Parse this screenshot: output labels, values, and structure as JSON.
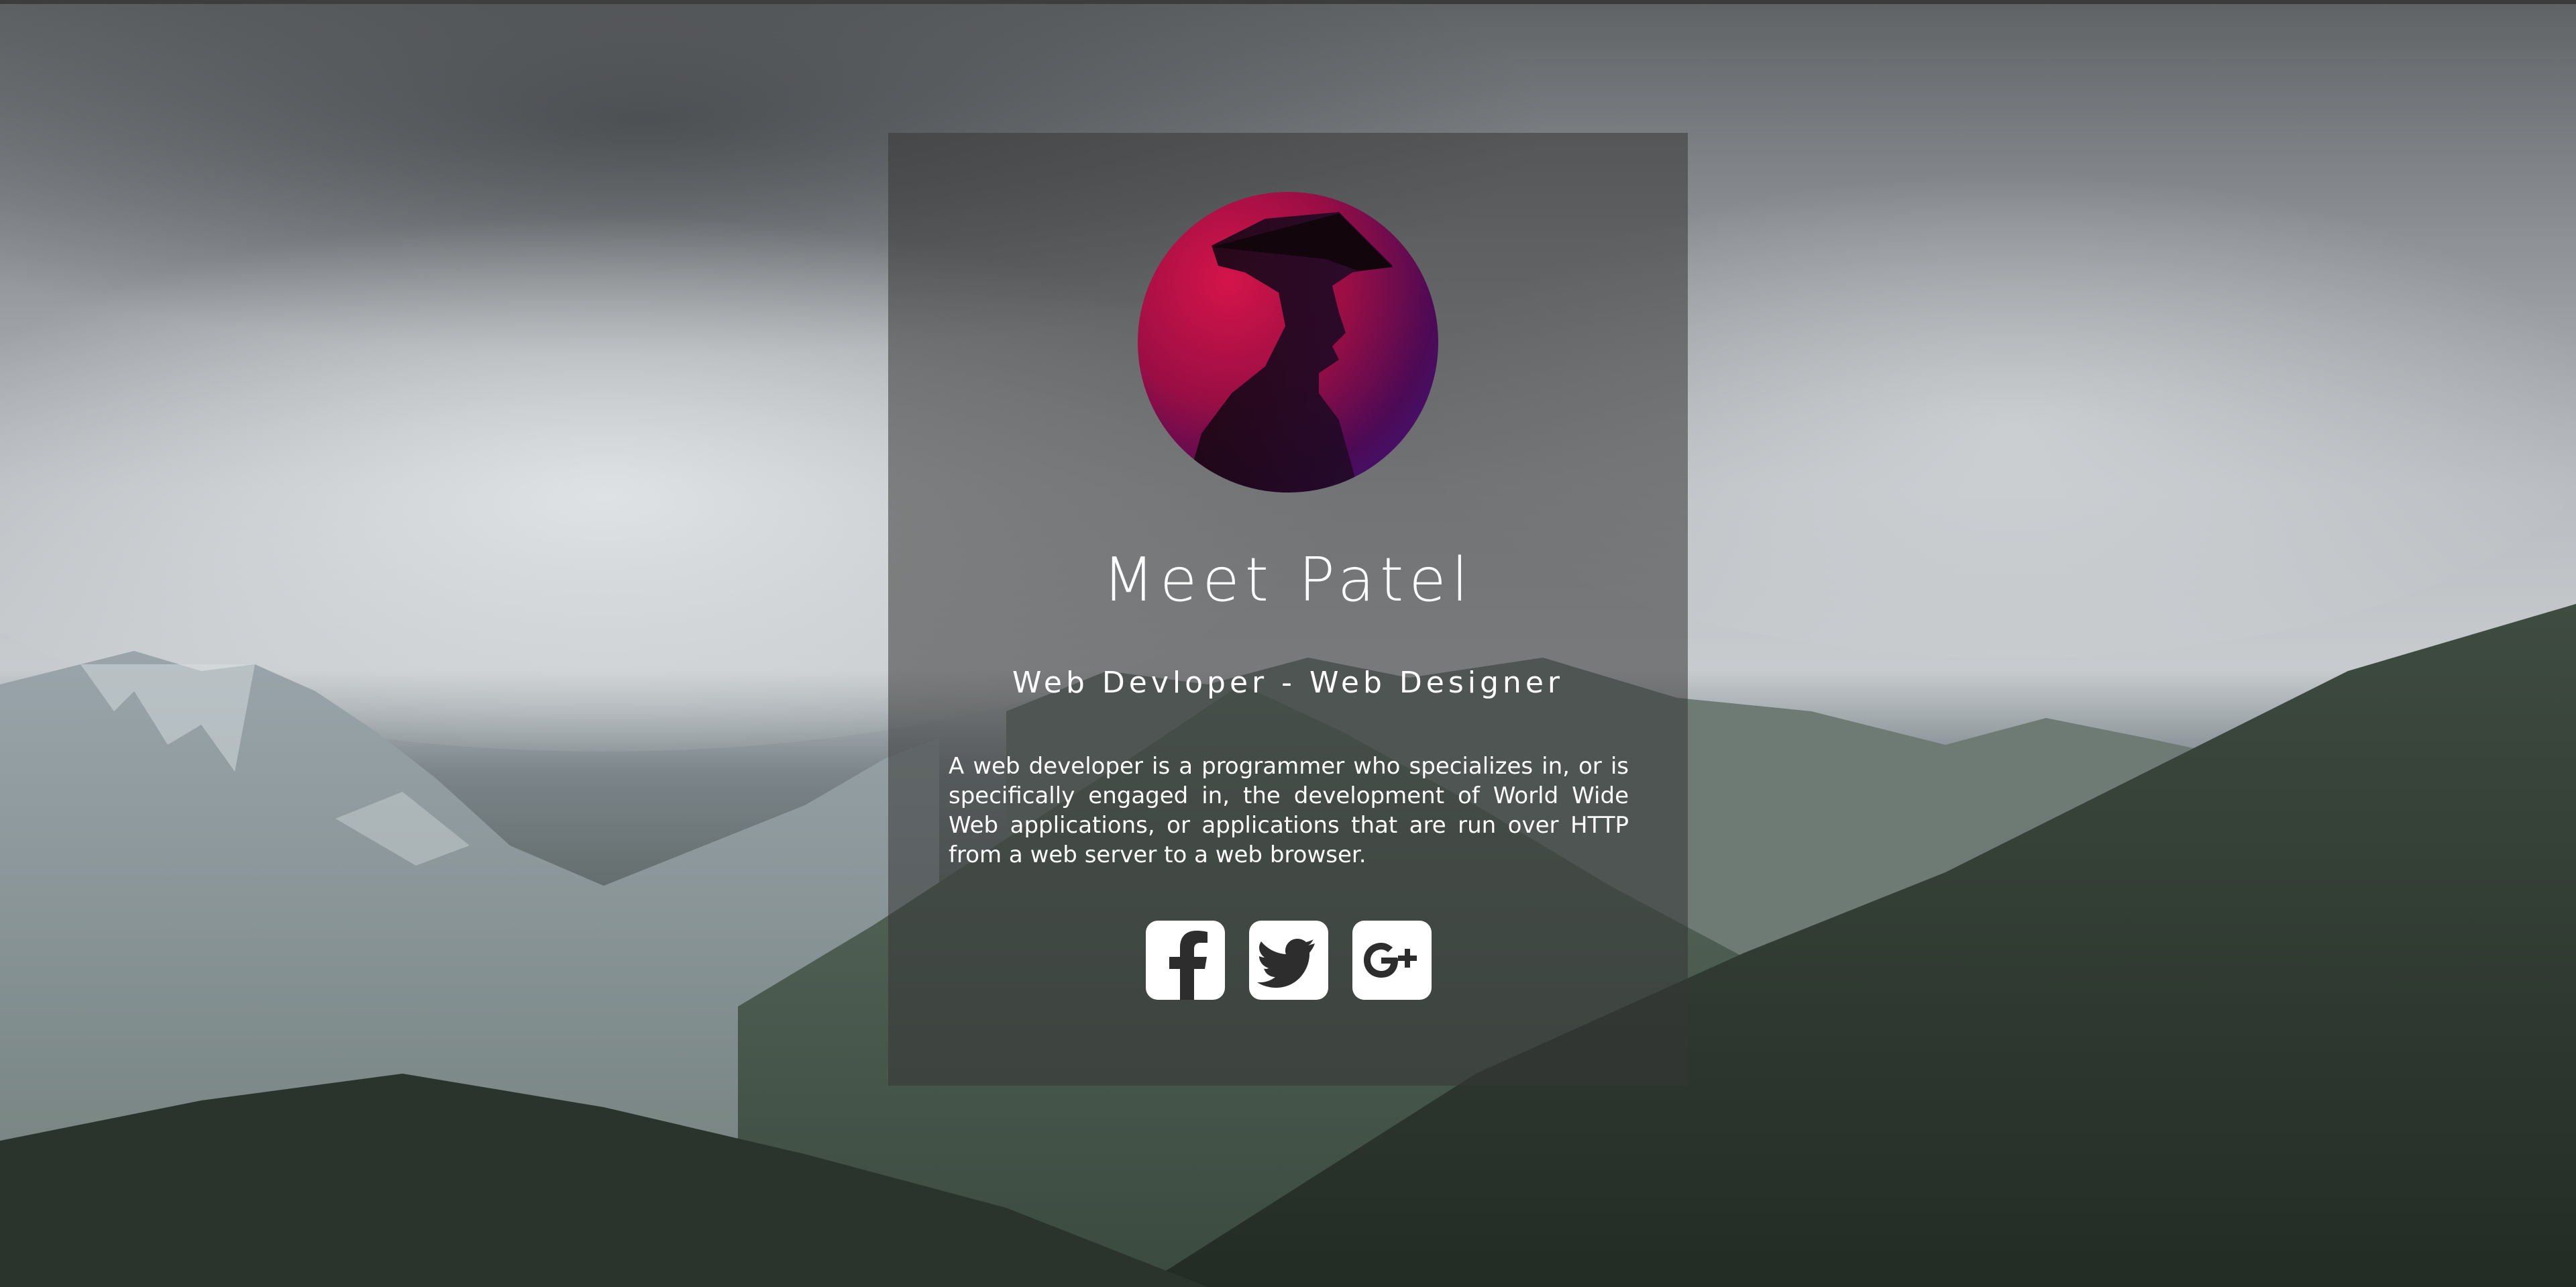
{
  "profile": {
    "name": "Meet Patel",
    "role": "Web Devloper - Web Designer",
    "bio": "A web developer is a programmer who specializes in, or is specifically engaged in, the development of World Wide Web applications, or applications that are run over HTTP from a web server to a web browser."
  },
  "social": {
    "items": [
      {
        "icon": "facebook-icon"
      },
      {
        "icon": "twitter-icon"
      },
      {
        "icon": "google-plus-icon"
      }
    ]
  },
  "colors": {
    "card_overlay": "#373737",
    "text": "#ffffff",
    "icon_button_bg": "#ffffff",
    "avatar_gradient_start": "#d4144a",
    "avatar_gradient_end": "#3a1a8a"
  }
}
